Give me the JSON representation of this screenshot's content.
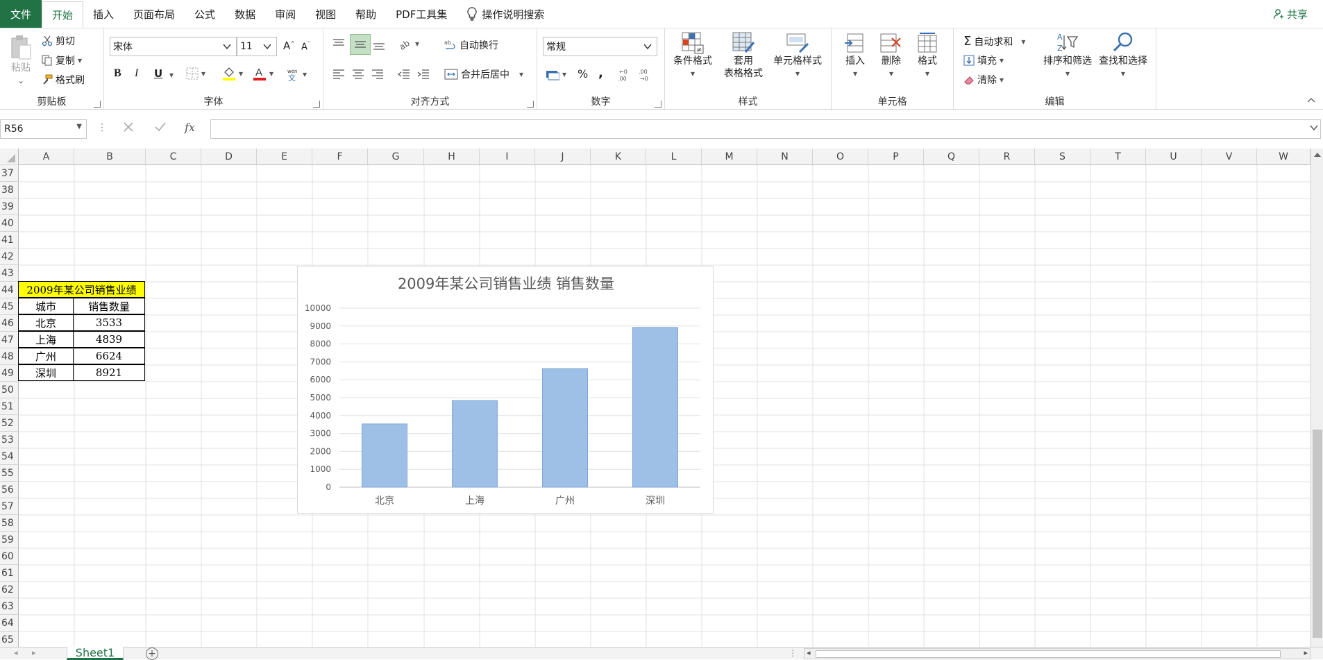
{
  "tabs": {
    "file": "文件",
    "items": [
      "开始",
      "插入",
      "页面布局",
      "公式",
      "数据",
      "审阅",
      "视图",
      "帮助",
      "PDF工具集"
    ],
    "tell_me": "操作说明搜索",
    "share": "共享"
  },
  "ribbon": {
    "clipboard": {
      "paste": "粘贴",
      "cut": "剪切",
      "copy": "复制",
      "format_painter": "格式刷",
      "label": "剪贴板"
    },
    "font": {
      "name": "宋体",
      "size": "11",
      "bold": "B",
      "italic": "I",
      "underline": "U",
      "label": "字体"
    },
    "alignment": {
      "wrap": "自动换行",
      "merge": "合并后居中",
      "label": "对齐方式"
    },
    "number": {
      "format": "常规",
      "percent": "%",
      "comma": ",",
      "label": "数字"
    },
    "styles": {
      "cond": "条件格式",
      "table_l1": "套用",
      "table_l2": "表格格式",
      "cell_styles": "单元格样式",
      "label": "样式"
    },
    "cells": {
      "insert": "插入",
      "delete": "删除",
      "format": "格式",
      "label": "单元格"
    },
    "editing": {
      "autosum": "自动求和",
      "fill": "填充",
      "clear": "清除",
      "sort": "排序和筛选",
      "find": "查找和选择",
      "label": "编辑"
    }
  },
  "formula_bar": {
    "name_box": "R56",
    "fx": "fx",
    "value": ""
  },
  "columns": [
    "A",
    "B",
    "C",
    "D",
    "E",
    "F",
    "G",
    "H",
    "I",
    "J",
    "K",
    "L",
    "M",
    "N",
    "O",
    "P",
    "Q",
    "R",
    "S",
    "T",
    "U",
    "V",
    "W"
  ],
  "rows": [
    "37",
    "38",
    "39",
    "40",
    "41",
    "42",
    "43",
    "44",
    "45",
    "46",
    "47",
    "48",
    "49",
    "50",
    "51",
    "52",
    "53",
    "54",
    "55",
    "56",
    "57",
    "58",
    "59",
    "60",
    "61",
    "62",
    "63",
    "64",
    "65"
  ],
  "table": {
    "title": "2009年某公司销售业绩",
    "headers": [
      "城市",
      "销售数量"
    ],
    "rows": [
      [
        "北京",
        "3533"
      ],
      [
        "上海",
        "4839"
      ],
      [
        "广州",
        "6624"
      ],
      [
        "深圳",
        "8921"
      ]
    ]
  },
  "sheets": {
    "active": "Sheet1"
  },
  "colors": {
    "excel_green": "#217346",
    "title_fill": "#ffff00",
    "bar": "#9ec0e6"
  },
  "chart_data": {
    "type": "bar",
    "title": "2009年某公司销售业绩 销售数量",
    "categories": [
      "北京",
      "上海",
      "广州",
      "深圳"
    ],
    "values": [
      3533,
      4839,
      6624,
      8921
    ],
    "ylim": [
      0,
      10000
    ],
    "yticks": [
      "0",
      "1000",
      "2000",
      "3000",
      "4000",
      "5000",
      "6000",
      "7000",
      "8000",
      "9000",
      "10000"
    ],
    "grid": true,
    "legend": "none"
  }
}
